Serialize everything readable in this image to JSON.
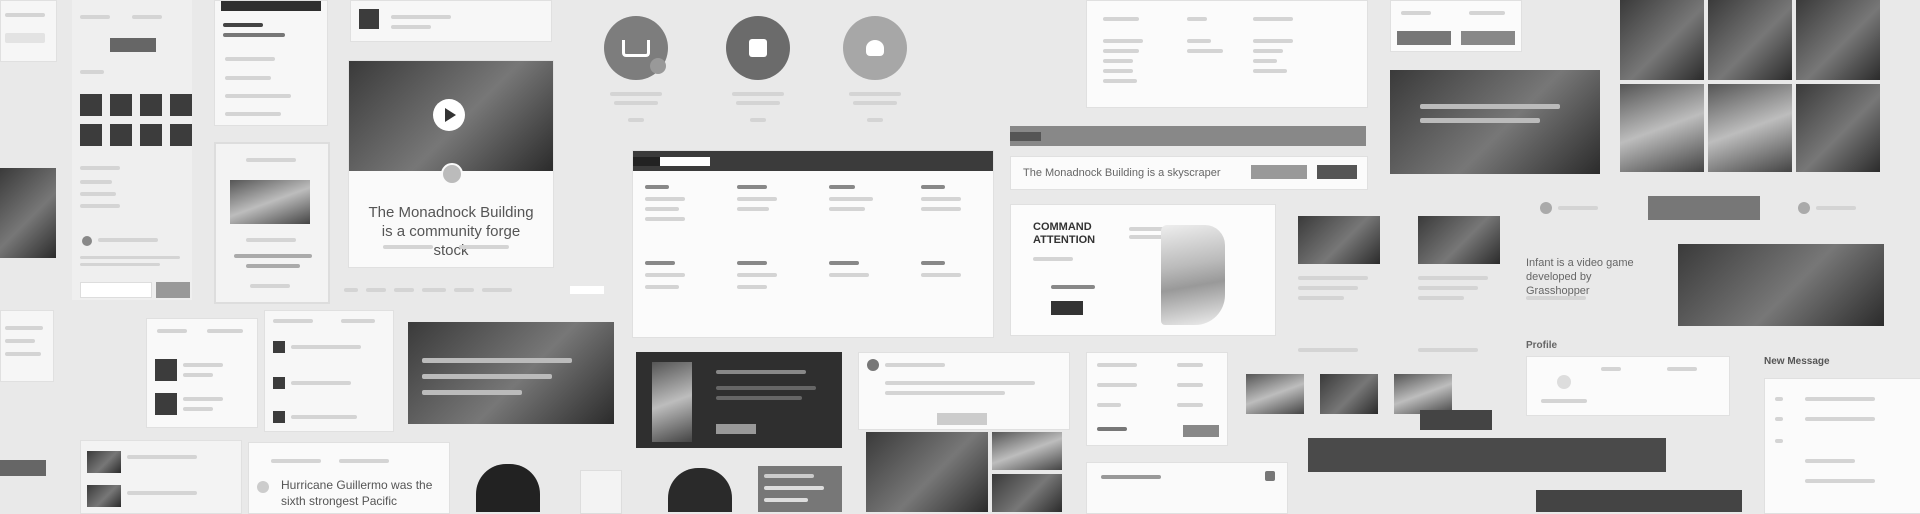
{
  "tiles": {
    "article_title": "The Monadnock Building is a community forge stock",
    "search_headline": "The Monadnock Building is a skyscraper",
    "callout_title": "COMMAND ATTENTION",
    "news_title": "Hurricane Guillermo was the sixth strongest Pacific",
    "video_title": "Infant is a video game developed by Grasshopper",
    "profile_label": "Profile",
    "message_label": "New Message"
  },
  "colors": {
    "background": "#e9e9e9",
    "dark": "#3b3b3b",
    "accent_gray": "#777777"
  }
}
